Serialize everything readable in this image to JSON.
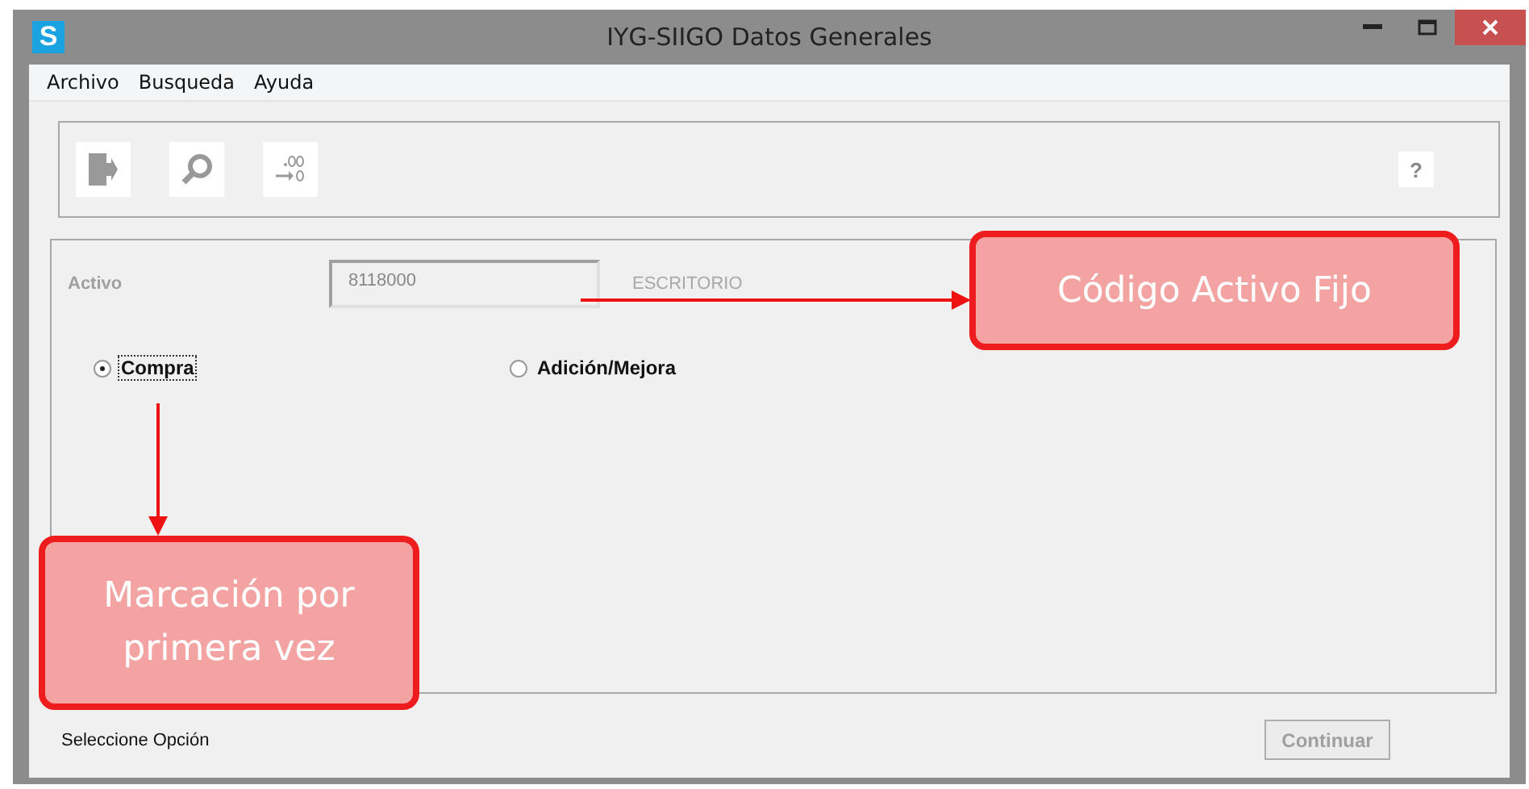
{
  "window": {
    "title": "IYG-SIIGO Datos Generales",
    "app_icon": "S"
  },
  "menu": [
    "Archivo",
    "Busqueda",
    "Ayuda"
  ],
  "toolbar": {
    "help": "?"
  },
  "form": {
    "label": "Activo",
    "code": "8118000",
    "description": "ESCRITORIO"
  },
  "options": [
    {
      "label": "Compra",
      "selected": true
    },
    {
      "label": "Adición/Mejora",
      "selected": false
    }
  ],
  "status": "Seleccione Opción",
  "continue_button": {
    "label": "Continuar",
    "disabled": true
  },
  "callouts": [
    {
      "kind": "right",
      "text": "Código Activo Fijo"
    },
    {
      "kind": "down",
      "text": "Marcación por primera vez"
    }
  ]
}
